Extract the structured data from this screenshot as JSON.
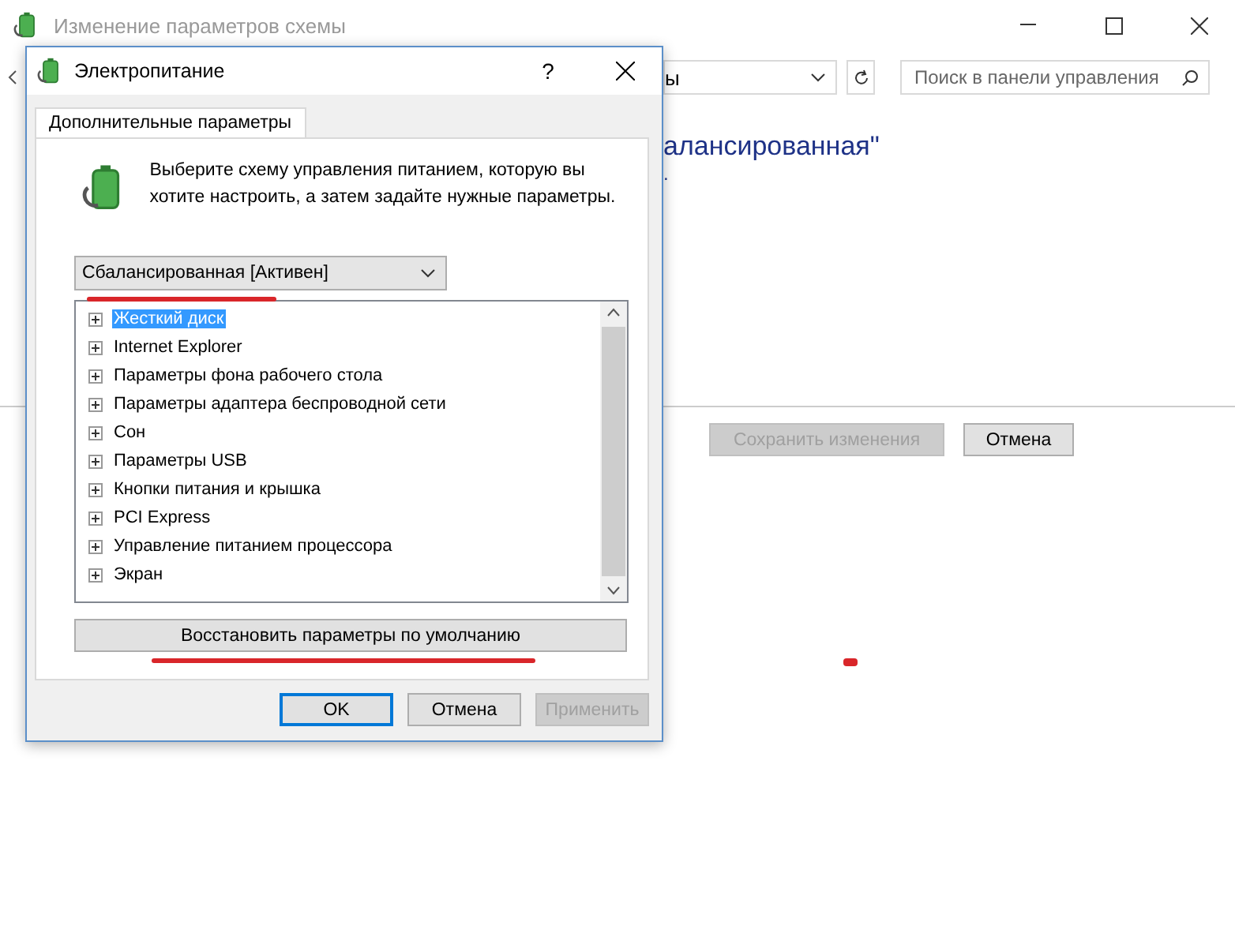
{
  "back_window": {
    "title": "Изменение параметров схемы",
    "address": "ы",
    "search": {
      "placeholder": "Поиск в панели управления"
    },
    "heading": "алансированная\"",
    "heading_2": ".",
    "buttons": [
      {
        "label": "Сохранить изменения",
        "disabled": true
      },
      {
        "label": "Отмена",
        "disabled": false
      }
    ]
  },
  "dialog": {
    "title": "Электропитание",
    "help": "?",
    "tabs": [
      {
        "label": "Дополнительные параметры",
        "selected": true
      }
    ],
    "description": "Выберите схему управления питанием, которую вы хотите настроить, а затем задайте нужные параметры.",
    "scheme": "Сбалансированная [Активен]",
    "tree": [
      {
        "label": "Жесткий диск",
        "selected": true,
        "expanded": false
      },
      {
        "label": "Internet Explorer",
        "selected": false,
        "expanded": false
      },
      {
        "label": "Параметры фона рабочего стола",
        "selected": false,
        "expanded": false
      },
      {
        "label": "Параметры адаптера беспроводной сети",
        "selected": false,
        "expanded": false
      },
      {
        "label": "Сон",
        "selected": false,
        "expanded": false
      },
      {
        "label": "Параметры USB",
        "selected": false,
        "expanded": false
      },
      {
        "label": "Кнопки питания и крышка",
        "selected": false,
        "expanded": false
      },
      {
        "label": "PCI Express",
        "selected": false,
        "expanded": false
      },
      {
        "label": "Управление питанием процессора",
        "selected": false,
        "expanded": false
      },
      {
        "label": "Экран",
        "selected": false,
        "expanded": false
      }
    ],
    "restore_button": "Восстановить параметры по умолчанию",
    "buttons": [
      {
        "label": "OK",
        "disabled": false,
        "default": true
      },
      {
        "label": "Отмена",
        "disabled": false,
        "default": false
      },
      {
        "label": "Применить",
        "disabled": true,
        "default": false
      }
    ]
  }
}
